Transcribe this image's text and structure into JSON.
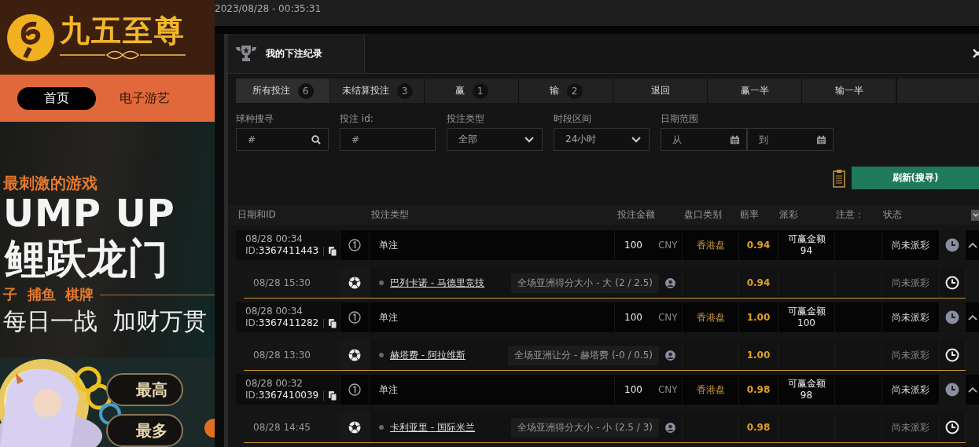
{
  "site": {
    "logo_text": "九五至尊",
    "nav": [
      {
        "label": "首页",
        "selected": true
      },
      {
        "label": "电子游艺",
        "selected": false
      }
    ],
    "banner": {
      "tagline": "最刺激的游戏",
      "headline": "UMP UP",
      "title": "鲤跃龙门",
      "categories": "子  捕鱼  棋牌",
      "slogan": "每日一战  加财万贯",
      "buttons": [
        "最高",
        "最多"
      ]
    }
  },
  "timestamp": "2023/08/28 - 00:35:31",
  "modal": {
    "title": "我的下注纪录",
    "tabs": [
      {
        "label": "所有投注",
        "count": "6",
        "selected": true
      },
      {
        "label": "未结算投注",
        "count": "3",
        "selected": false
      },
      {
        "label": "赢",
        "count": "1",
        "selected": false
      },
      {
        "label": "输",
        "count": "2",
        "selected": false
      },
      {
        "label": "退回",
        "selected": false
      },
      {
        "label": "赢一半",
        "selected": false
      },
      {
        "label": "输一半",
        "selected": false
      }
    ],
    "filters": [
      {
        "kind": "search",
        "label": "球种搜寻",
        "placeholder": "#"
      },
      {
        "kind": "text",
        "label": "投注 id:",
        "placeholder": "#"
      },
      {
        "kind": "select",
        "label": "投注类型",
        "value": "全部"
      },
      {
        "kind": "select",
        "label": "时段区间",
        "value": "24小时"
      },
      {
        "kind": "daterange",
        "label": "日期范围",
        "from_placeholder": "从",
        "to_placeholder": "到"
      }
    ],
    "refresh_button": "刷新(搜寻)",
    "table": {
      "columns": [
        "日期和ID",
        "投注类型",
        "投注金额",
        "盘口类别",
        "赔率",
        "派彩",
        "注意：",
        "状态"
      ],
      "bets": [
        {
          "date": "08/28 00:34",
          "id_label": "ID:",
          "id": "3367411443",
          "type": "单注",
          "amount": "100",
          "currency": "CNY",
          "market": "香港盘",
          "odds": "0.94",
          "payout_label": "可赢金额",
          "payout": "94",
          "status": "尚未派彩",
          "expanded": true,
          "legs": [
            {
              "time": "08/28 15:30",
              "match": "巴列卡诺 - 马德里竞技",
              "selection": "全场亚洲得分大小 - 大 (2 / 2.5)",
              "odds": "0.94",
              "status": "尚未派彩"
            }
          ]
        },
        {
          "date": "08/28 00:34",
          "id_label": "ID:",
          "id": "3367411282",
          "type": "单注",
          "amount": "100",
          "currency": "CNY",
          "market": "香港盘",
          "odds": "1.00",
          "payout_label": "可赢金额",
          "payout": "100",
          "status": "尚未派彩",
          "expanded": true,
          "legs": [
            {
              "time": "08/28 13:30",
              "match": "赫塔费 - 阿拉维斯",
              "selection": "全场亚洲让分 - 赫塔费 (-0 / 0.5)",
              "odds": "1.00",
              "status": "尚未派彩"
            }
          ]
        },
        {
          "date": "08/28 00:32",
          "id_label": "ID:",
          "id": "3367410039",
          "type": "单注",
          "amount": "100",
          "currency": "CNY",
          "market": "香港盘",
          "odds": "0.98",
          "payout_label": "可赢金额",
          "payout": "98",
          "status": "尚未派彩",
          "expanded": true,
          "legs": [
            {
              "time": "08/28 14:45",
              "match": "卡利亚里 - 国际米兰",
              "selection": "全场亚洲得分大小 - 小 (2.5 / 3)",
              "odds": "0.98",
              "status": "尚未派彩"
            }
          ]
        }
      ]
    }
  }
}
